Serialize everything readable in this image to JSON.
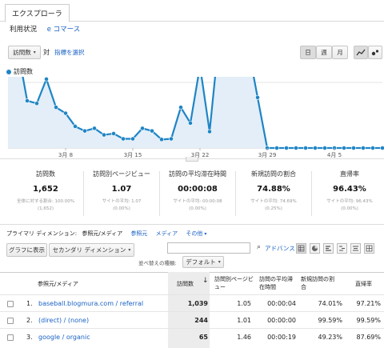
{
  "tabs": {
    "explorer": "エクスプローラ"
  },
  "subnav": {
    "usage": "利用状況",
    "ecommerce": "e コマース"
  },
  "controls": {
    "metric_select": "訪問数",
    "vs": "対",
    "select_metric_link": "指標を選択",
    "period": {
      "day": "日",
      "week": "週",
      "month": "月"
    }
  },
  "chart_data": {
    "type": "line",
    "title": "",
    "legend": "訪問数",
    "ylabel": "",
    "xlabel": "",
    "ylim": [
      0,
      200
    ],
    "y_ticks": [
      100,
      200
    ],
    "x_tick_labels": [
      "3月 8",
      "3月 15",
      "3月 22",
      "3月 29",
      "4月 5"
    ],
    "x": [
      "3月 2",
      "3月 3",
      "3月 4",
      "3月 5",
      "3月 6",
      "3月 7",
      "3月 8",
      "3月 9",
      "3月 10",
      "3月 11",
      "3月 12",
      "3月 13",
      "3月 14",
      "3月 15",
      "3月 16",
      "3月 17",
      "3月 18",
      "3月 19",
      "3月 20",
      "3月 21",
      "3月 22",
      "3月 23",
      "3月 24",
      "3月 25",
      "3月 26",
      "3月 27",
      "3月 28",
      "3月 29",
      "3月 30",
      "3月 31",
      "4月 1",
      "4月 2",
      "4月 3",
      "4月 4",
      "4月 5",
      "4月 6",
      "4月 7",
      "4月 8",
      "4月 9",
      "4月 10"
    ],
    "series": [
      {
        "name": "訪問数",
        "color": "#1f85c5",
        "values": [
          127,
          152,
          72,
          68,
          105,
          62,
          53,
          33,
          26,
          30,
          20,
          22,
          14,
          14,
          30,
          26,
          13,
          14,
          62,
          38,
          125,
          25,
          170,
          190,
          170,
          155,
          77,
          0,
          0,
          0,
          0,
          0,
          0,
          0,
          0,
          0,
          0,
          0,
          0,
          0
        ]
      }
    ]
  },
  "summary": [
    {
      "label": "訪問数",
      "value": "1,652",
      "sub1": "全体に対する割合: 100.00%",
      "sub2": "(1,652)"
    },
    {
      "label": "訪問別ページビュー",
      "value": "1.07",
      "sub1": "サイトの平均: 1.07",
      "sub2": "(0.00%)"
    },
    {
      "label": "訪問の平均滞在時間",
      "value": "00:00:08",
      "sub1": "サイトの平均: 00:00:08",
      "sub2": "(0.00%)"
    },
    {
      "label": "新規訪問の割合",
      "value": "74.88%",
      "sub1": "サイトの平均: 74.69%",
      "sub2": "(0.25%)"
    },
    {
      "label": "直帰率",
      "value": "96.43%",
      "sub1": "サイトの平均: 96.43%",
      "sub2": "(0.00%)"
    }
  ],
  "dimension": {
    "label": "プライマリ ディメンション:",
    "current": "参照元/メディア",
    "options": [
      "参照元",
      "メディア",
      "その他"
    ]
  },
  "table_controls": {
    "plot_rows": "グラフに表示",
    "secondary_dimension": "セカンダリ ディメンション",
    "sort_label": "並べ替えの種類:",
    "sort_value": "デフォルト",
    "advanced": "アドバンス",
    "search_placeholder": ""
  },
  "table": {
    "headers": [
      "参照元/メディア",
      "訪問数",
      "訪問別ページビュー",
      "訪問の平均滞在時間",
      "新規訪問の割合",
      "直帰率"
    ],
    "rows": [
      {
        "index": "1.",
        "source": "baseball.blogmura.com / referral",
        "visits": "1,039",
        "ppv": "1.05",
        "duration": "00:00:04",
        "new": "74.01%",
        "bounce": "97.21%"
      },
      {
        "index": "2.",
        "source": "(direct) / (none)",
        "visits": "244",
        "ppv": "1.01",
        "duration": "00:00:00",
        "new": "99.59%",
        "bounce": "99.59%"
      },
      {
        "index": "3.",
        "source": "google / organic",
        "visits": "65",
        "ppv": "1.46",
        "duration": "00:00:19",
        "new": "49.23%",
        "bounce": "87.69%"
      }
    ]
  }
}
